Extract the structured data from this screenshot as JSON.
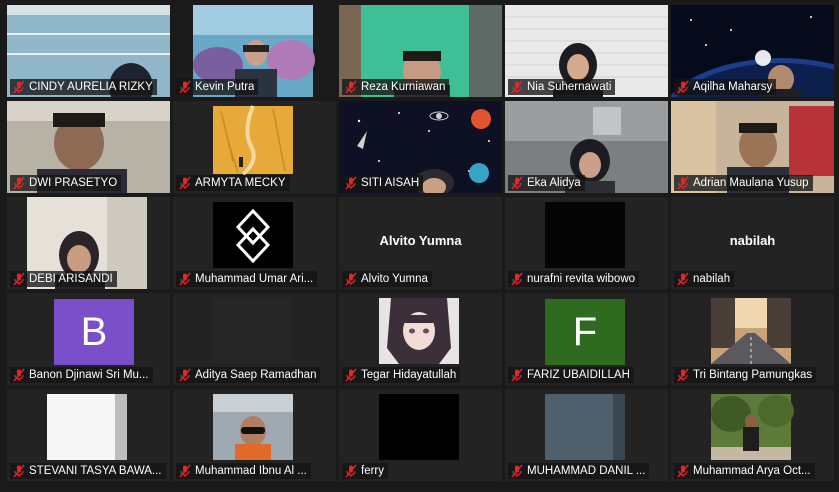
{
  "participants": [
    {
      "name": "CINDY AURELIA RIZKY"
    },
    {
      "name": "Kevin Putra"
    },
    {
      "name": "Reza Kurniawan"
    },
    {
      "name": "Nia Suhernawati"
    },
    {
      "name": "Aqilha Maharsy"
    },
    {
      "name": "DWI PRASETYO"
    },
    {
      "name": "ARMYTA MECKY"
    },
    {
      "name": "SITI AISAH"
    },
    {
      "name": "Eka Alidya"
    },
    {
      "name": "Adrian Maulana Yusup"
    },
    {
      "name": "DEBI ARISANDI"
    },
    {
      "name": "Muhammad Umar Ari..."
    },
    {
      "name": "Alvito Yumna",
      "display_name": "Alvito Yumna"
    },
    {
      "name": "nurafni revita wibowo"
    },
    {
      "name": "nabilah",
      "display_name": "nabilah"
    },
    {
      "name": "Banon Djinawi Sri Mu...",
      "avatar_letter": "B",
      "avatar_color": "#7b4fc9"
    },
    {
      "name": "Aditya Saep Ramadhan"
    },
    {
      "name": "Tegar Hidayatullah"
    },
    {
      "name": "FARIZ UBAIDILLAH",
      "avatar_letter": "F",
      "avatar_color": "#2f6b1f"
    },
    {
      "name": "Tri Bintang Pamungkas"
    },
    {
      "name": "STEVANI TASYA BAWA..."
    },
    {
      "name": "Muhammad Ibnu Al ..."
    },
    {
      "name": "ferry"
    },
    {
      "name": "MUHAMMAD DANIL ..."
    },
    {
      "name": "Muhammad Arya Oct..."
    }
  ],
  "icons": {
    "mic_state": "microphone-muted-icon"
  },
  "colors": {
    "muted_icon": "#e02828",
    "tile_bg": "#232323",
    "page_bg": "#1a1a1a"
  }
}
